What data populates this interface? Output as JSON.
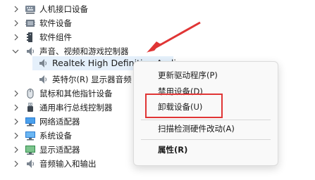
{
  "tree": {
    "items": [
      {
        "label": "人机接口设备",
        "expanded": false,
        "icon": "hid-icon"
      },
      {
        "label": "软件设备",
        "expanded": false,
        "icon": "software-device-icon"
      },
      {
        "label": "软件组件",
        "expanded": false,
        "icon": "software-component-icon"
      },
      {
        "label": "声音、视频和游戏控制器",
        "expanded": true,
        "icon": "speaker-icon"
      },
      {
        "label": "Realtek High Definition Audio",
        "child": true,
        "selected": true,
        "icon": "speaker-icon"
      },
      {
        "label": "英特尔(R) 显示器音频",
        "child": true,
        "icon": "speaker-icon"
      },
      {
        "label": "鼠标和其他指针设备",
        "expanded": false,
        "icon": "mouse-icon"
      },
      {
        "label": "通用串行总线控制器",
        "expanded": false,
        "icon": "usb-icon"
      },
      {
        "label": "网络适配器",
        "expanded": false,
        "icon": "network-icon"
      },
      {
        "label": "系统设备",
        "expanded": false,
        "icon": "system-device-icon"
      },
      {
        "label": "显示适配器",
        "expanded": false,
        "icon": "display-adapter-icon"
      },
      {
        "label": "音频输入和输出",
        "expanded": false,
        "icon": "speaker-icon"
      }
    ]
  },
  "context_menu": {
    "items": [
      {
        "label": "更新驱动程序(P)"
      },
      {
        "label": "禁用设备(D)"
      },
      {
        "label": "卸载设备(U)",
        "highlighted": true
      },
      {
        "label": "扫描检测硬件改动(A)"
      },
      {
        "label": "属性(R)",
        "bold": true
      }
    ]
  },
  "colors": {
    "annotation_red": "#e03535",
    "selection_bg": "#e5f0fb"
  }
}
